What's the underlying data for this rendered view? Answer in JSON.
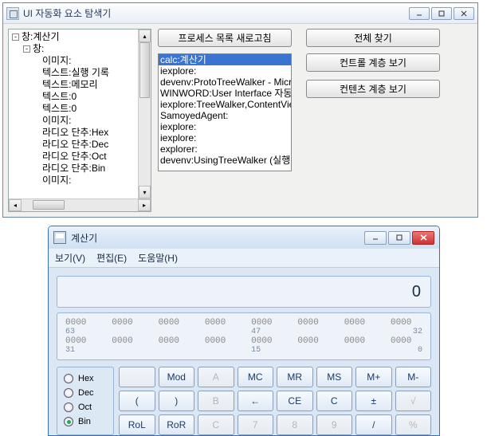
{
  "win1": {
    "title": "UI 자동화 요소 탐색기",
    "tree": [
      {
        "indent": 1,
        "exp": "-",
        "text": "창:계산기"
      },
      {
        "indent": 2,
        "exp": "-",
        "text": "창:"
      },
      {
        "indent": 3,
        "text": "이미지:"
      },
      {
        "indent": 3,
        "text": "텍스트:실행 기록"
      },
      {
        "indent": 3,
        "text": "텍스트:메모리"
      },
      {
        "indent": 3,
        "text": "텍스트:0"
      },
      {
        "indent": 3,
        "text": "텍스트:0"
      },
      {
        "indent": 3,
        "text": "이미지:"
      },
      {
        "indent": 3,
        "text": "라디오 단추:Hex"
      },
      {
        "indent": 3,
        "text": "라디오 단추:Dec"
      },
      {
        "indent": 3,
        "text": "라디오 단추:Oct"
      },
      {
        "indent": 3,
        "text": "라디오 단추:Bin"
      },
      {
        "indent": 3,
        "text": "이미지:"
      }
    ],
    "btn_refresh": "프로세스 목록 새로고침",
    "btn_findall": "전체 찾기",
    "btn_ctrl": "컨트롤 계층 보기",
    "btn_content": "컨텐츠 계층 보기",
    "processes": [
      {
        "text": "calc:계산기",
        "sel": true
      },
      {
        "text": "iexplore:"
      },
      {
        "text": "devenv:ProtoTreeWalker - Micr"
      },
      {
        "text": "WINWORD:User Interface 자동화"
      },
      {
        "text": "iexplore:TreeWalker,ContentVie"
      },
      {
        "text": "SamoyedAgent:"
      },
      {
        "text": "iexplore:"
      },
      {
        "text": "iexplore:"
      },
      {
        "text": "explorer:"
      },
      {
        "text": "devenv:UsingTreeWalker (실행"
      }
    ]
  },
  "win2": {
    "title": "계산기",
    "menu": [
      "보기(V)",
      "편집(E)",
      "도움말(H)"
    ],
    "display": "0",
    "bits": {
      "row1": [
        "0000",
        "0000",
        "0000",
        "0000",
        "0000",
        "0000",
        "0000",
        "0000"
      ],
      "lbl1": [
        "63",
        "",
        "",
        "",
        "47",
        "",
        "",
        "32"
      ],
      "row2": [
        "0000",
        "0000",
        "0000",
        "0000",
        "0000",
        "0000",
        "0000",
        "0000"
      ],
      "lbl2": [
        "31",
        "",
        "",
        "",
        "15",
        "",
        "",
        "0"
      ]
    },
    "radios": [
      {
        "label": "Hex",
        "on": false
      },
      {
        "label": "Dec",
        "on": false
      },
      {
        "label": "Oct",
        "on": false
      },
      {
        "label": "Bin",
        "on": true
      }
    ],
    "keys_r1": [
      {
        "t": "",
        "dis": true
      },
      {
        "t": "Mod"
      },
      {
        "t": "A",
        "dis": true
      },
      {
        "t": "MC"
      },
      {
        "t": "MR"
      },
      {
        "t": "MS"
      },
      {
        "t": "M+"
      },
      {
        "t": "M-"
      }
    ],
    "keys_r2": [
      {
        "t": "( "
      },
      {
        "t": " )"
      },
      {
        "t": "B",
        "dis": true
      },
      {
        "t": "←"
      },
      {
        "t": "CE"
      },
      {
        "t": "C"
      },
      {
        "t": "±"
      },
      {
        "t": "√",
        "dis": true
      }
    ],
    "keys_r3": [
      {
        "t": "RoL"
      },
      {
        "t": "RoR"
      },
      {
        "t": "C",
        "dis": true
      },
      {
        "t": "7",
        "dis": true
      },
      {
        "t": "8",
        "dis": true
      },
      {
        "t": "9",
        "dis": true
      },
      {
        "t": "/"
      },
      {
        "t": "%",
        "dis": true
      }
    ]
  }
}
